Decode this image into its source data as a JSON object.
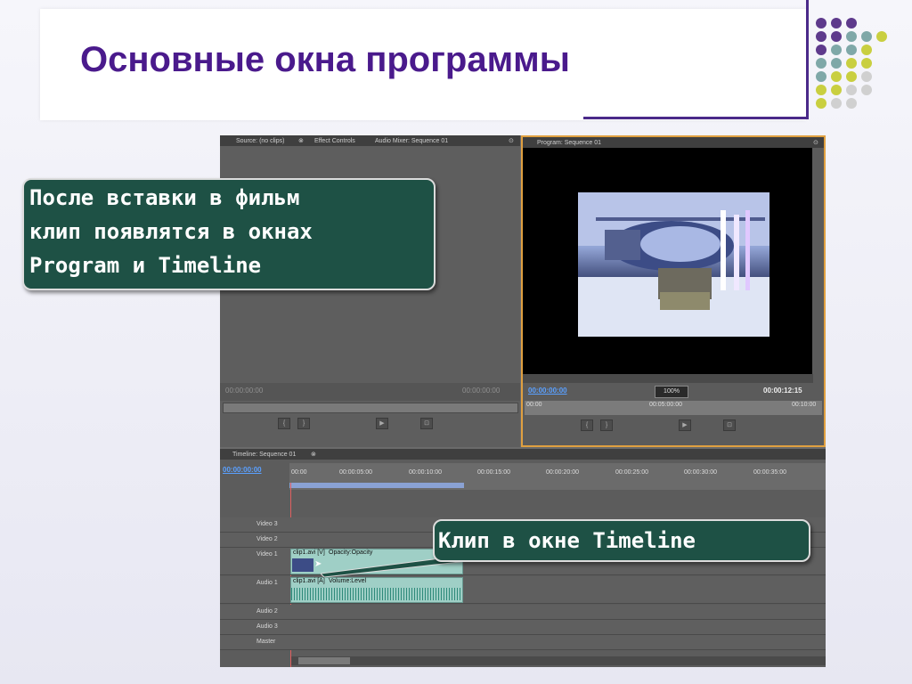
{
  "slide": {
    "title": "Основные окна программы",
    "accent_color": "#4a1a8c",
    "dot_colors": [
      "#5e3a8c",
      "#7fa8a8",
      "#c9cf40",
      "#d0d0d0"
    ]
  },
  "callouts": {
    "first_lines": [
      "После вставки в фильм",
      "клип появлятся в окнах",
      "Program и Timeline"
    ],
    "second": "Клип в окне Timeline"
  },
  "source_panel": {
    "tabs": [
      "Source: (no clips)",
      "Effect Controls",
      "Audio Mixer: Sequence 01"
    ],
    "timecode_left": "00:00:00:00",
    "timecode_right": "00:00:00:00"
  },
  "program_panel": {
    "tab": "Program: Sequence 01",
    "timecode_current": "00:00:00:00",
    "zoom": "100%",
    "timecode_duration": "00:00:12:15",
    "ruler": [
      "00:00",
      "00:05:00:00",
      "00:10:00"
    ]
  },
  "timeline_panel": {
    "tab": "Timeline: Sequence 01",
    "timecode": "00:00:00:00",
    "ruler": [
      "00:00",
      "00:00:05:00",
      "00:00:10:00",
      "00:00:15:00",
      "00:00:20:00",
      "00:00:25:00",
      "00:00:30:00",
      "00:00:35:00"
    ],
    "tracks": [
      "Video 3",
      "Video 2",
      "Video 1",
      "Audio 1",
      "Audio 2",
      "Audio 3",
      "Master"
    ],
    "video_clip": {
      "name": "clip1.avi [V]",
      "effect": "Opacity:Opacity"
    },
    "audio_clip": {
      "name": "clip1.avi [A]",
      "effect": "Volume:Level"
    }
  },
  "icons": [
    "panel-menu-icon",
    "close-icon",
    "play-icon",
    "step-back-icon",
    "step-forward-icon",
    "eye-icon",
    "speaker-icon",
    "mouse-cursor-icon"
  ]
}
